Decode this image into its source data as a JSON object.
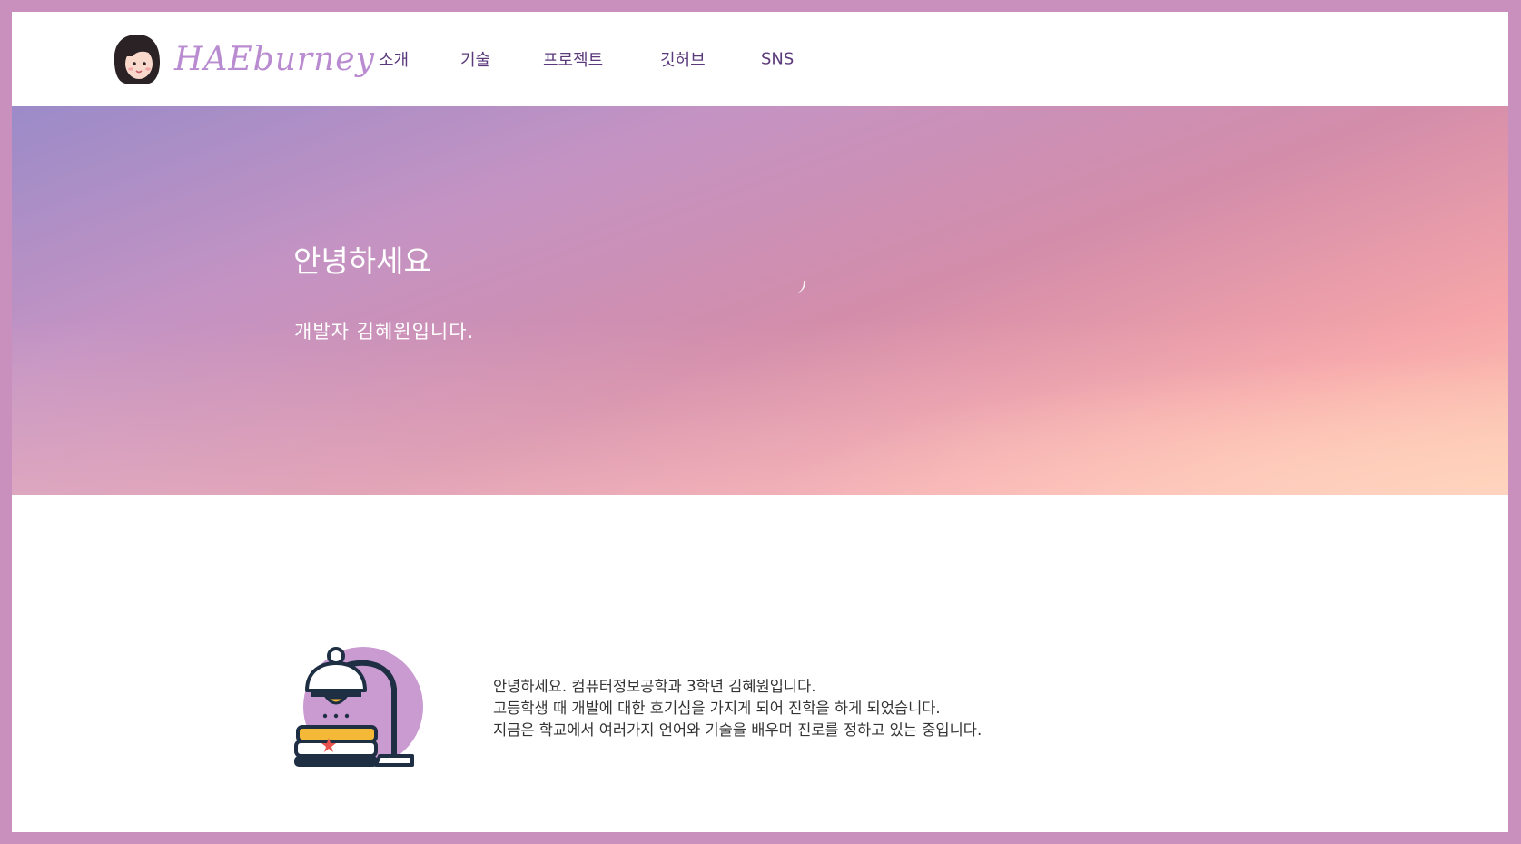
{
  "header": {
    "brand_name": "HAEburney",
    "nav": [
      {
        "label": "소개"
      },
      {
        "label": "기술"
      },
      {
        "label": "프로젝트"
      },
      {
        "label": "깃허브"
      },
      {
        "label": "SNS"
      }
    ]
  },
  "hero": {
    "title": "안녕하세요",
    "subtitle": "개발자 김혜원입니다."
  },
  "about": {
    "illustration_icon": "desk-lamp-books-icon",
    "lines": [
      "안녕하세요. 컴퓨터정보공학과 3학년 김혜원입니다.",
      "고등학생 때 개발에 대한 호기심을 가지게 되어 진학을 하게 되었습니다.",
      "지금은 학교에서 여러가지 언어와 기술을 배우며 진로를 정하고 있는 중입니다."
    ]
  },
  "colors": {
    "frame_border": "#c98fbd",
    "nav_text": "#5b3a7c",
    "brand_text": "#b98bd0",
    "illustration_circle": "#c99bd1"
  }
}
